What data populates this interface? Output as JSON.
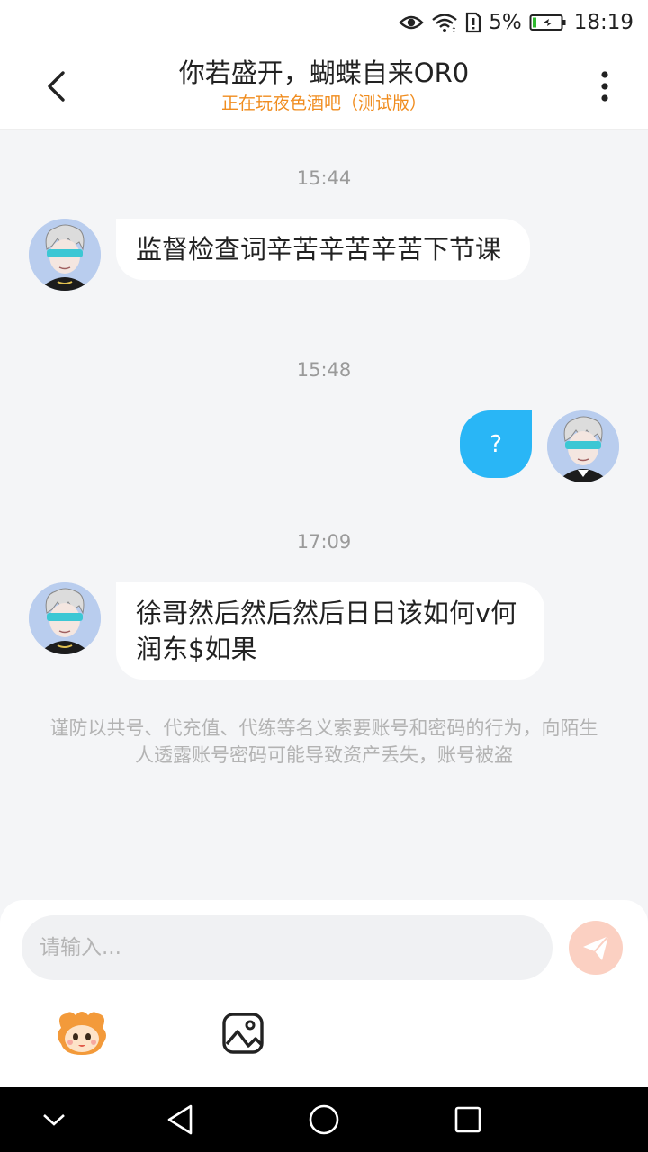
{
  "status_bar": {
    "battery_percent": "5%",
    "time": "18:19",
    "icons": [
      "eye-icon",
      "wifi-icon",
      "sim-alert-icon",
      "battery-icon"
    ]
  },
  "header": {
    "title": "你若盛开，蝴蝶自来OR0",
    "subtitle": "正在玩夜色酒吧（测试版）"
  },
  "messages": [
    {
      "time": "15:44",
      "direction": "in",
      "text": "监督检查词辛苦辛苦辛苦下节课"
    },
    {
      "time": "15:48",
      "direction": "out",
      "text": "?"
    },
    {
      "time": "17:09",
      "direction": "in",
      "text": "徐哥然后然后然后日日该如何v何润东$如果"
    }
  ],
  "notice": "谨防以共号、代充值、代练等名义索要账号和密码的行为，向陌生人透露账号密码可能导致资产丢失，账号被盗",
  "composer": {
    "placeholder": "请输入..."
  },
  "colors": {
    "accent_blue": "#29b6f6",
    "subtitle_orange": "#f08c1e",
    "send_button": "#fbd0c2"
  }
}
